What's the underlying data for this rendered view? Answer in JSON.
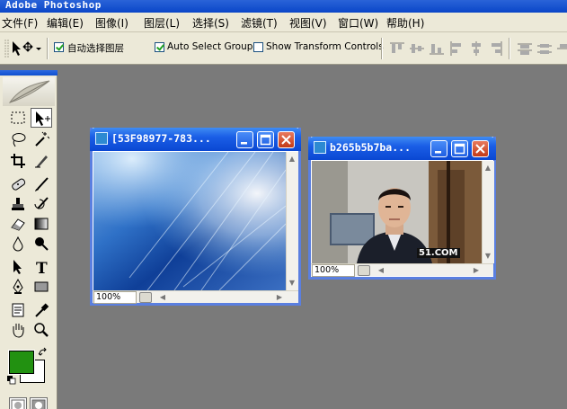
{
  "app": {
    "title": "Adobe Photoshop"
  },
  "menu": [
    {
      "label": "文件(F)"
    },
    {
      "label": "编辑(E)"
    },
    {
      "label": "图像(I)"
    },
    {
      "label": "图层(L)"
    },
    {
      "label": "选择(S)"
    },
    {
      "label": "滤镜(T)"
    },
    {
      "label": "视图(V)"
    },
    {
      "label": "窗口(W)"
    },
    {
      "label": "帮助(H)"
    }
  ],
  "options": {
    "auto_select_layer": {
      "label": "自动选择图层",
      "checked": true
    },
    "auto_select_groups": {
      "label": "Auto Select Groups",
      "checked": true
    },
    "show_transform_controls": {
      "label": "Show Transform Controls",
      "checked": false
    }
  },
  "colors": {
    "foreground": "#229111",
    "background": "#ffffff",
    "title_bar": "#0a46c8",
    "workspace": "#7a7a7a"
  },
  "documents": [
    {
      "title": "[53F98977-783...",
      "zoom": "100%"
    },
    {
      "title": "b265b5b7ba...",
      "zoom": "100%",
      "watermark": "51.COM"
    }
  ],
  "window_buttons": {
    "minimize": "minimize-icon",
    "maximize": "maximize-icon",
    "close": "close-icon"
  }
}
